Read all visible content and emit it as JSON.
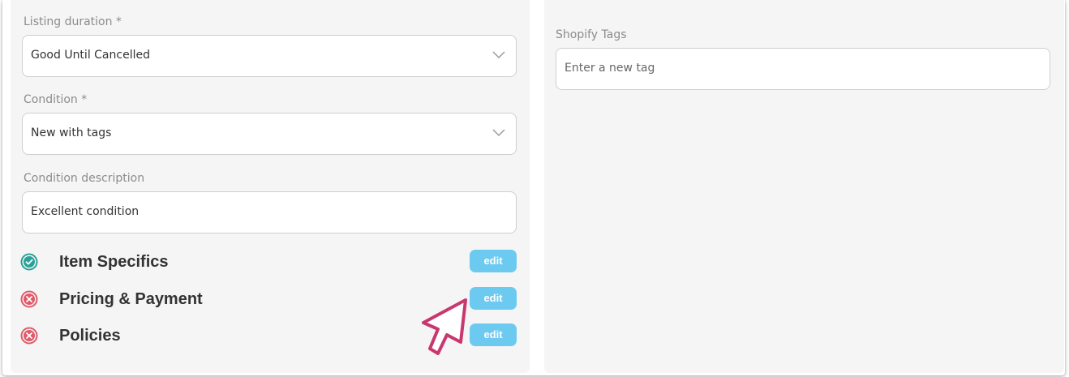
{
  "listing_duration": {
    "label": "Listing duration *",
    "value": "Good Until Cancelled"
  },
  "condition": {
    "label": "Condition *",
    "value": "New with tags"
  },
  "condition_description": {
    "label": "Condition description",
    "value": "Excellent condition"
  },
  "sections": [
    {
      "label": "Item Specifics",
      "status": "complete",
      "status_icon": "check-circle-icon",
      "status_color": "#2aa198",
      "button_label": "edit"
    },
    {
      "label": "Pricing & Payment",
      "status": "error",
      "status_icon": "x-circle-icon",
      "status_color": "#e05a6a",
      "button_label": "edit"
    },
    {
      "label": "Policies",
      "status": "error",
      "status_icon": "x-circle-icon",
      "status_color": "#e05a6a",
      "button_label": "edit"
    }
  ],
  "shopify_tags": {
    "label": "Shopify Tags",
    "placeholder": "Enter a new tag"
  },
  "colors": {
    "accent_button": "#6ccaf0",
    "cursor": "#c8386e"
  }
}
